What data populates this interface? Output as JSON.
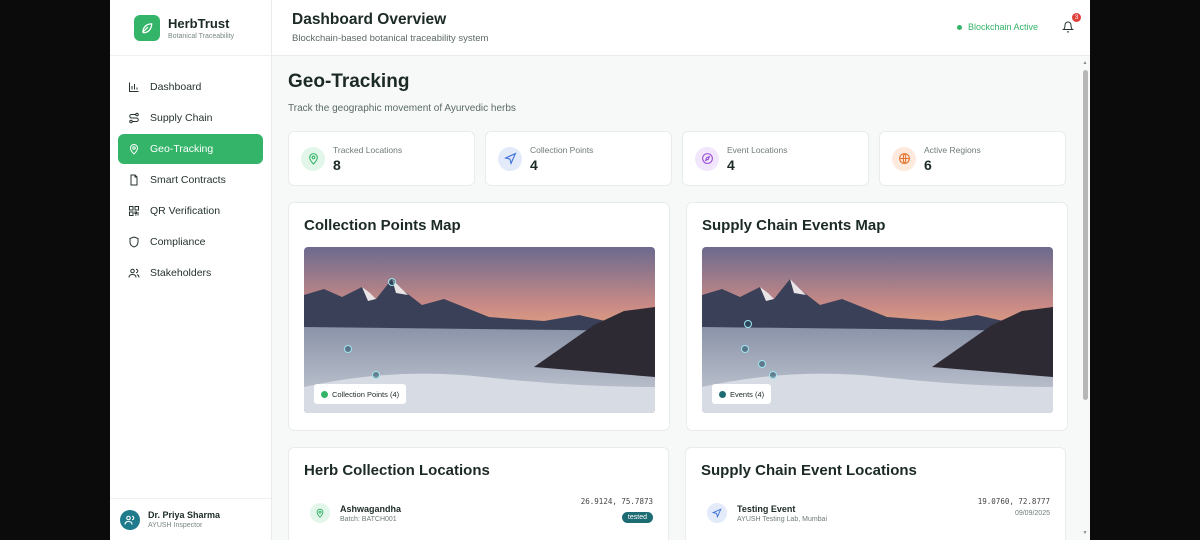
{
  "brand": {
    "name": "HerbTrust",
    "subtitle": "Botanical Traceability"
  },
  "nav": [
    {
      "label": "Dashboard",
      "icon": "bar-chart-icon",
      "active": false
    },
    {
      "label": "Supply Chain",
      "icon": "route-icon",
      "active": false
    },
    {
      "label": "Geo-Tracking",
      "icon": "map-pin-icon",
      "active": true
    },
    {
      "label": "Smart Contracts",
      "icon": "file-icon",
      "active": false
    },
    {
      "label": "QR Verification",
      "icon": "qr-code-icon",
      "active": false
    },
    {
      "label": "Compliance",
      "icon": "shield-icon",
      "active": false
    },
    {
      "label": "Stakeholders",
      "icon": "users-icon",
      "active": false
    }
  ],
  "user": {
    "name": "Dr. Priya Sharma",
    "role": "AYUSH Inspector"
  },
  "header": {
    "title": "Dashboard Overview",
    "subtitle": "Blockchain-based botanical traceability system",
    "status": "Blockchain Active",
    "notifications": "3"
  },
  "page": {
    "title": "Geo-Tracking",
    "subtitle": "Track the geographic movement of Ayurvedic herbs"
  },
  "stats": [
    {
      "label": "Tracked Locations",
      "value": "8",
      "icon": "map-pin-icon",
      "color": "#34b469",
      "bg": "#e3f6ea"
    },
    {
      "label": "Collection Points",
      "value": "4",
      "icon": "navigation-icon",
      "color": "#3b6fd9",
      "bg": "#e3ebfb"
    },
    {
      "label": "Event Locations",
      "value": "4",
      "icon": "compass-icon",
      "color": "#9a4fd6",
      "bg": "#f1e6fb"
    },
    {
      "label": "Active Regions",
      "value": "6",
      "icon": "globe-icon",
      "color": "#e2702a",
      "bg": "#fdeadd"
    }
  ],
  "maps": {
    "collection": {
      "title": "Collection Points Map",
      "legend": "Collection Points (4)",
      "legend_color": "#34b469"
    },
    "events": {
      "title": "Supply Chain Events Map",
      "legend": "Events (4)",
      "legend_color": "#1d6b73"
    }
  },
  "collection_locations": {
    "title": "Herb Collection Locations",
    "items": [
      {
        "name": "Ashwagandha",
        "batch": "Batch: BATCH001",
        "coords": "26.9124, 75.7873",
        "status": "tested"
      }
    ]
  },
  "event_locations": {
    "title": "Supply Chain Event Locations",
    "items": [
      {
        "name": "Testing Event",
        "place": "AYUSH Testing Lab, Mumbai",
        "coords": "19.0760, 72.8777",
        "date": "09/09/2025"
      }
    ]
  }
}
